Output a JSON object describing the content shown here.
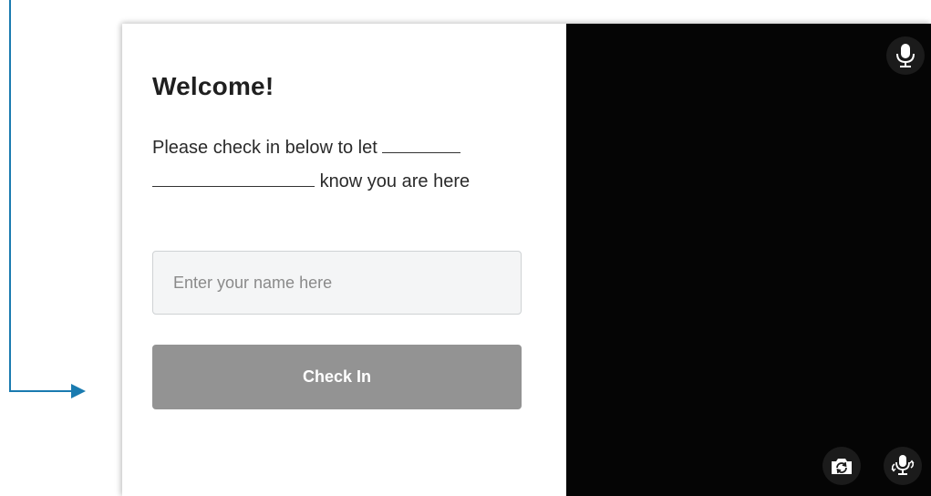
{
  "welcome": {
    "title": "Welcome!",
    "message_part1": "Please check in below to let",
    "message_part2": "know you are here"
  },
  "form": {
    "name_placeholder": "Enter your name here",
    "name_value": "",
    "submit_label": "Check In"
  },
  "camera": {
    "top_icon": "microphone-icon",
    "bottom_icons": [
      "camera-flip-icon",
      "microphone-switch-icon"
    ]
  },
  "colors": {
    "callout_arrow": "#1a7bb0",
    "button_bg": "#939393",
    "camera_bg": "#050505"
  }
}
